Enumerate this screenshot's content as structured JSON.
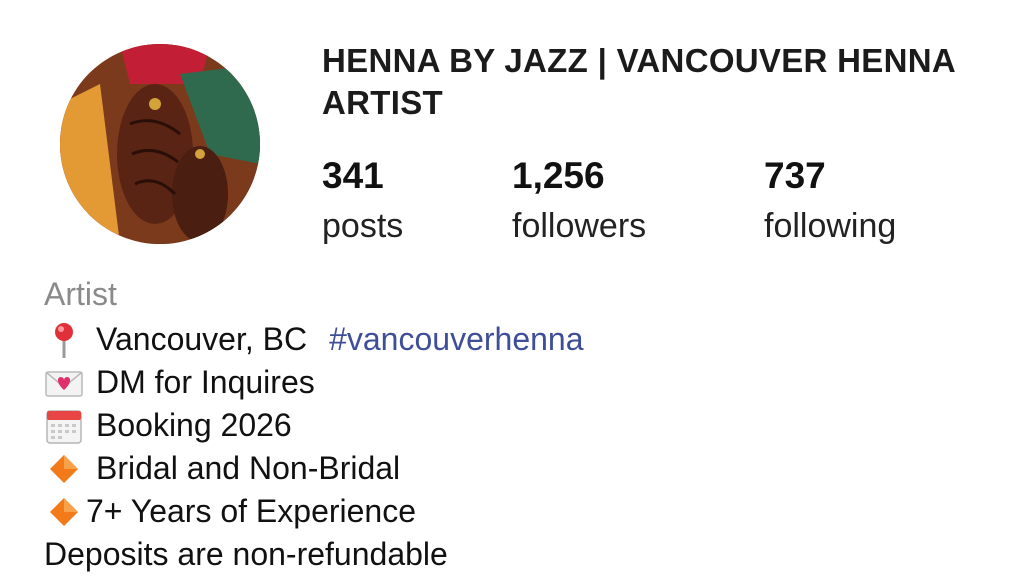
{
  "profile": {
    "name": "HENNA BY JAZZ | VANCOUVER HENNA ARTIST",
    "stats": {
      "posts_count": "341",
      "posts_label": "posts",
      "followers_count": "1,256",
      "followers_label": "followers",
      "following_count": "737",
      "following_label": "following"
    },
    "category": "Artist",
    "bio": {
      "location": "Vancouver, BC",
      "hashtag": "#vancouverhenna",
      "dm": "DM for Inquires",
      "booking": "Booking 2026",
      "bridal": "Bridal and Non-Bridal",
      "experience": "7+ Years of Experience",
      "deposits": "Deposits are non-refundable"
    },
    "icons": [
      "round-pushpin-icon",
      "love-letter-icon",
      "calendar-icon",
      "orange-diamond-icon",
      "orange-diamond-icon"
    ]
  }
}
